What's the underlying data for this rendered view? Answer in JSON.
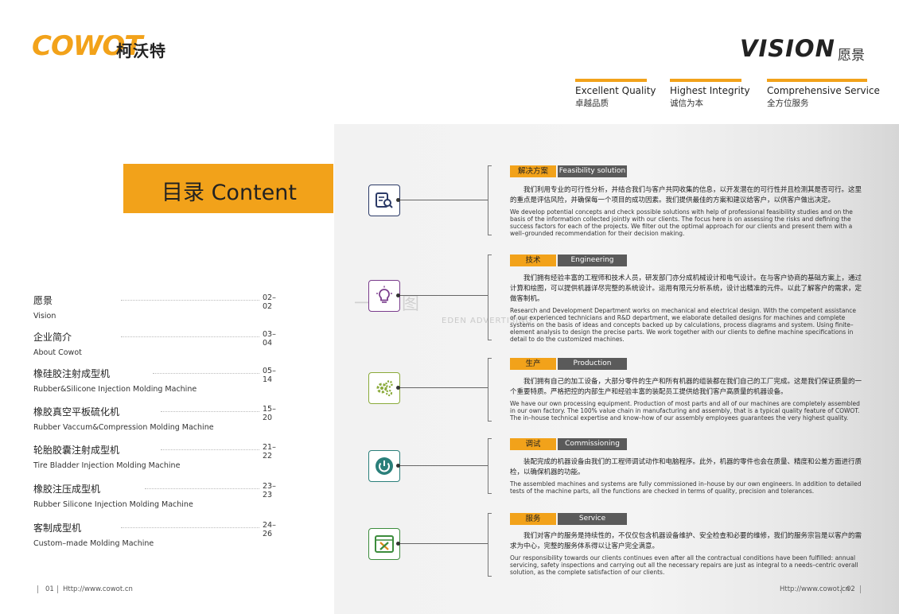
{
  "brand": {
    "logo_latin": "COWOT",
    "logo_cn": "柯沃特"
  },
  "header": {
    "title": "VISION",
    "title_cn": "愿景",
    "taglines": [
      {
        "en": "Excellent Quality",
        "cn": "卓越品质"
      },
      {
        "en": "Highest Integrity",
        "cn": "诚信为本"
      },
      {
        "en": "Comprehensive Service",
        "cn": "全方位服务"
      }
    ]
  },
  "banner": {
    "title": "目录 Content"
  },
  "toc": [
    {
      "cn": "愿景",
      "en": "Vision",
      "pages": "02–02"
    },
    {
      "cn": "企业简介",
      "en": "About Cowot",
      "pages": "03–04"
    },
    {
      "cn": "橡硅胶注射成型机",
      "en": "Rubber&Silicone Injection Molding Machine",
      "pages": "05–14"
    },
    {
      "cn": "橡胶真空平板硫化机",
      "en": "Rubber Vaccum&Compression Molding Machine",
      "pages": "15–20"
    },
    {
      "cn": "轮胎胶囊注射成型机",
      "en": "Tire Bladder Injection Molding Machine",
      "pages": "21–22"
    },
    {
      "cn": "橡胶注压成型机",
      "en": "Rubber Silicone Injection Molding Machine",
      "pages": "23–23"
    },
    {
      "cn": "客制成型机",
      "en": "Custom–made Molding Machine",
      "pages": "24–26"
    }
  ],
  "sections": [
    {
      "tag_cn": "解决方案",
      "tag_en": "Feasibility solution",
      "icon": "search-document-icon",
      "cn": "我们利用专业的可行性分析，并结合我们与客户共同收集的信息，以开发潜在的可行性并且检测其是否可行。这里的重点是评估风险，并确保每一个项目的成功因素。我们提供最佳的方案和建议给客户，以供客户做出决定。",
      "en": "We develop potential concepts and check possible solutions with help of professional feasibility studies and on the basis of the information collected jointly with our clients. The focus here is on assessing the risks and defining the success factors for each of the projects. We filter out the optimal approach for our clients and present them with a well–grounded recommendation for their decision making."
    },
    {
      "tag_cn": "技术",
      "tag_en": "Engineering",
      "icon": "lightbulb-icon",
      "cn": "我们拥有经验丰富的工程师和技术人员，研发部门亦分成机械设计和电气设计。在与客户协商的基础方案上，通过计算和绘图，可以提供机器详尽完整的系统设计。运用有限元分析系统，设计出精准的元件。以此了解客户的需求，定做客制机。",
      "en": "Research and Development Department works on mechanical and electrical design. With the competent assistance of our experienced technicians and R&D department, we elaborate detailed designs for machines and complete systems on the basis of ideas and concepts backed up by calculations, process diagrams and system. Using finite–element analysis to design the precise parts. We work together with our clients to define machine specifications in detail to do the customized machines."
    },
    {
      "tag_cn": "生产",
      "tag_en": "Production",
      "icon": "gears-icon",
      "cn": "我们拥有自己的加工设备，大部分零件的生产和所有机器的组装都在我们自己的工厂完成。这是我们保证质量的一个重要特质。严格把控的内部生产和经验丰富的装配员工提供给我们客户高质量的机器设备。",
      "en": "We have our own processing equipment. Production of most parts and all of our machines are completely assembled in our own factory. The 100% value chain in manufacturing and assembly, that is a typical quality feature of COWOT. The in–house technical expertise and know–how of our assembly employees guarantees the very highest quality."
    },
    {
      "tag_cn": "调试",
      "tag_en": "Commissioning",
      "icon": "power-icon",
      "cn": "装配完成的机器设备由我们的工程师调试动作和电脑程序。此外，机器的零件也会在质量、精度和公差方面进行质检，以确保机器的功能。",
      "en": "The assembled machines and systems are fully commissioned in–house by our own engineers. In addition to detailed tests of the machine parts, all the functions are checked in terms of quality, precision and tolerances."
    },
    {
      "tag_cn": "服务",
      "tag_en": "Service",
      "icon": "tools-icon",
      "cn": "我们对客户的服务是持续性的，不仅仅包含机器设备维护、安全检查和必要的维修，我们的服务宗旨是以客户的需求为中心，完整的服务体系得以让客户完全满意。",
      "en": "Our responsibility towards our clients continues even after all the contractual conditions have been fulfilled: annual servicing, safety inspections and carrying out all the necessary repairs are just as integral to a needs–centric overall solution, as the complete satisfaction of our clients."
    }
  ],
  "watermark": {
    "cn": "一画图",
    "en": "EDEN ADVERTISING"
  },
  "footer": {
    "left_page": "01",
    "left_url": "Http://www.cowot.cn",
    "right_url": "Http://www.cowot.cn",
    "right_page": "02"
  },
  "colors": {
    "accent": "#f2a21a",
    "dark_tag": "#5a5a5a",
    "navy": "#2b3a67",
    "purple": "#7a3c8c",
    "olive": "#8aaa3a",
    "teal": "#2a7f7a",
    "green": "#3c8c3c"
  }
}
